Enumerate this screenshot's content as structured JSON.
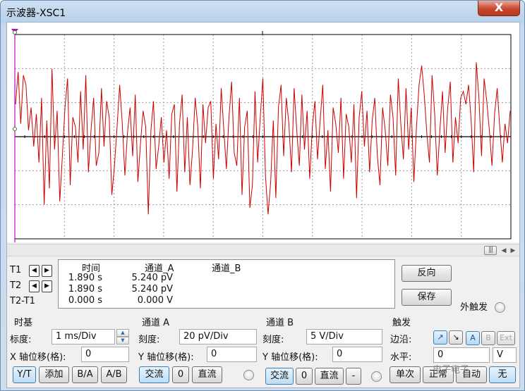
{
  "window": {
    "title": "示波器-XSC1",
    "close_glyph": "X"
  },
  "screen": {
    "background": "#ffffff",
    "grid_color": "#9a9a9a",
    "trace_color": "#cc0000",
    "cursor1_color": "#c400c4",
    "cursor2_color": "#000000"
  },
  "signal": {
    "description_values_in_divisions": [
      1.0,
      2.0,
      0.4,
      1.9,
      1.6,
      0.2,
      0.9,
      -0.3,
      0.7,
      -0.8,
      1.2,
      -2.1,
      0.5,
      -1.6,
      2.1,
      -0.4,
      0.8,
      -2.0,
      -0.6,
      0.9,
      1.8,
      -1.5,
      0.6,
      0.3,
      -0.8,
      1.4,
      -0.4,
      1.9,
      -1.1,
      0.2,
      1.2,
      -0.9,
      -0.5,
      1.5,
      -0.3,
      1.1,
      0.6,
      -1.8,
      -0.9,
      0.3,
      1.6,
      0.4,
      -1.2,
      0.1,
      0.9,
      -0.6,
      1.3,
      -1.4,
      -0.2,
      0.8,
      0.3,
      -2.4,
      0.2,
      1.1,
      -1.0,
      -0.3,
      0.6,
      -0.8,
      0.2,
      -1.3,
      0.7,
      1.0,
      -1.7,
      0.4,
      1.3,
      -1.1,
      0.6,
      -1.5,
      -0.4,
      1.2,
      0.3,
      -1.6,
      1.0,
      -0.2,
      0.9,
      1.1,
      -1.3,
      0.4,
      -0.7,
      1.5,
      0.2,
      -1.0,
      0.6,
      1.7,
      -0.5,
      -0.9,
      1.2,
      -1.8,
      0.3,
      0.8,
      -2.2,
      -1.5,
      1.4,
      -0.8,
      0.6,
      1.8,
      -1.2,
      -2.4,
      -1.4,
      0.5,
      -1.9,
      0.9,
      1.6,
      -0.6,
      1.2,
      0.4,
      -1.1,
      1.5,
      0.2,
      -0.9,
      1.3,
      -0.4,
      0.8,
      -1.3,
      0.3,
      1.1,
      -0.7,
      0.5,
      1.6,
      -1.0,
      0.2,
      -1.7,
      0.9,
      0.4,
      -0.5,
      1.2,
      -1.3,
      0.7,
      0.3,
      -0.8,
      1.0,
      -1.9,
      0.6,
      1.4,
      -0.3,
      0.8,
      -1.1,
      0.5,
      1.2,
      -0.6,
      -1.5,
      0.9,
      0.2,
      -0.9,
      1.3,
      0.6,
      -1.2,
      1.8,
      0.4,
      -0.7,
      1.5,
      -0.4,
      0.9,
      -1.4,
      0.3,
      1.6,
      2.2,
      1.3,
      0.1,
      -0.8,
      1.9,
      0.7,
      -1.2,
      0.2,
      1.4,
      -0.5,
      0.9,
      1.7,
      -0.8,
      0.6,
      -0.2,
      1.2,
      1.4,
      1.0,
      1.6,
      0.5,
      -1.1,
      2.3,
      1.2,
      -0.6,
      1.8,
      1.1,
      0.2,
      -0.9,
      0.7,
      1.5,
      0.3,
      -0.8,
      0.4,
      -0.2,
      0.8
    ]
  },
  "cursors": {
    "t1_label": "T1",
    "t2_label": "T2",
    "diff_label": "T2-T1",
    "left_arrow": "◀",
    "right_arrow": "▶"
  },
  "readout": {
    "headers": {
      "time": "时间",
      "channel_a": "通道_A",
      "channel_b": "通道_B"
    },
    "rows": [
      {
        "time": "1.890 s",
        "a": "5.240 pV",
        "b": ""
      },
      {
        "time": "1.890 s",
        "a": "5.240 pV",
        "b": ""
      },
      {
        "time": "0.000 s",
        "a": "0.000 V",
        "b": ""
      }
    ]
  },
  "actions": {
    "reverse": "反向",
    "save": "保存",
    "ext_trigger": "外触发"
  },
  "timebase": {
    "title": "时基",
    "scale_label": "标度:",
    "scale_value": "1 ms/Div",
    "xpos_label": "X 轴位移(格):",
    "xpos_value": "0",
    "modes": [
      "Y/T",
      "添加",
      "B/A",
      "A/B"
    ]
  },
  "channel_a": {
    "title": "通道 A",
    "scale_label": "刻度:",
    "scale_value": "20 pV/Div",
    "ypos_label": "Y 轴位移(格):",
    "ypos_value": "0",
    "coupling": [
      "交流",
      "0",
      "直流"
    ]
  },
  "channel_b": {
    "title": "通道 B",
    "scale_label": "刻度:",
    "scale_value": "5  V/Div",
    "ypos_label": "Y 轴位移(格):",
    "ypos_value": "0",
    "coupling": [
      "交流",
      "0",
      "直流",
      "-"
    ]
  },
  "trigger": {
    "title": "触发",
    "edge_label": "边沿:",
    "edge_buttons": [
      "↗",
      "↘"
    ],
    "source_buttons": [
      "A",
      "B",
      "Ext"
    ],
    "level_label": "水平:",
    "level_value": "0",
    "level_unit": "V",
    "modes": [
      "单次",
      "正常",
      "自动",
      "无"
    ]
  },
  "watermark": {
    "text": "电子电子"
  }
}
